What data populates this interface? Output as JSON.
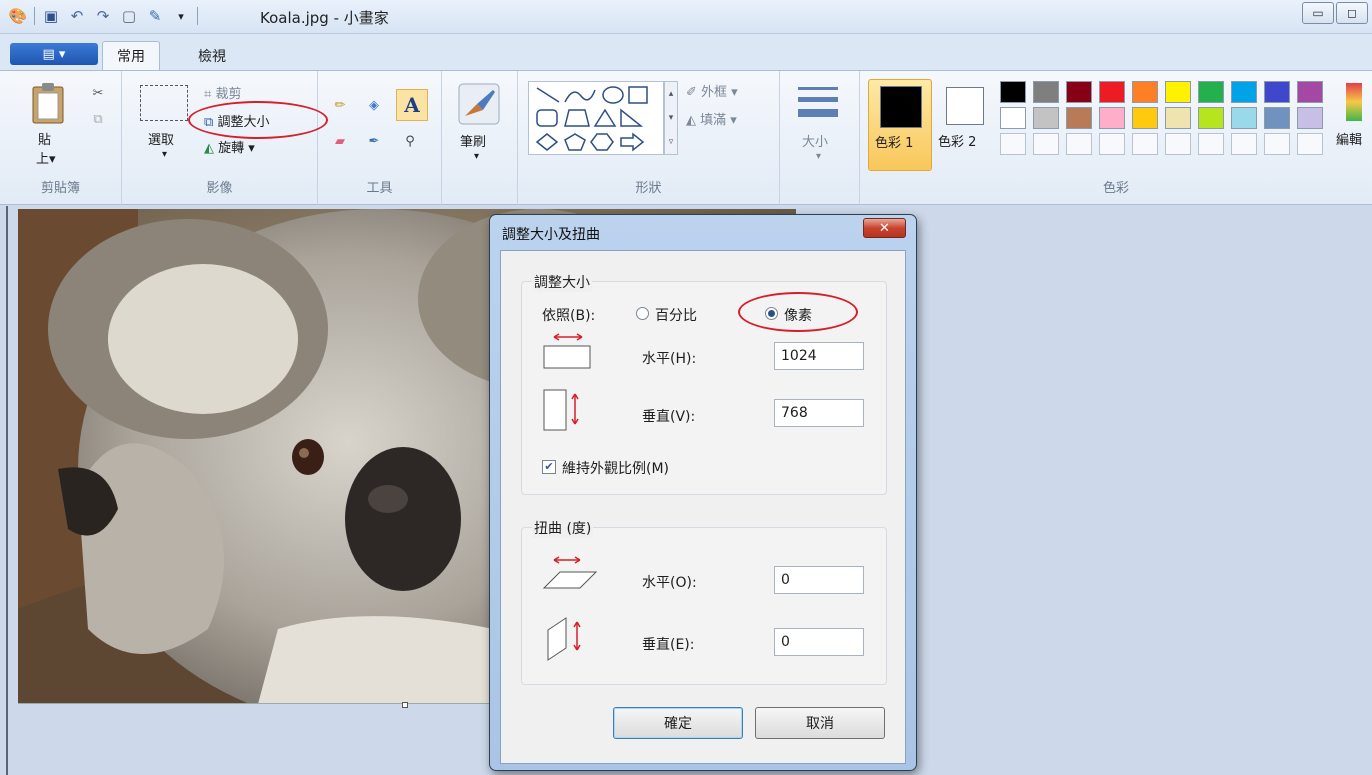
{
  "window": {
    "title": "Koala.jpg - 小畫家"
  },
  "tabs": {
    "home": "常用",
    "view": "檢視"
  },
  "clipboard": {
    "paste": "貼",
    "paste2": "上",
    "label": "剪貼簿"
  },
  "image": {
    "select": "選取",
    "crop": "裁剪",
    "resize": "調整大小",
    "rotate": "旋轉",
    "label": "影像"
  },
  "tools": {
    "label": "工具"
  },
  "brushes": {
    "label": "筆刷"
  },
  "shapes": {
    "outline": "外框",
    "fill": "填滿",
    "label": "形狀"
  },
  "size": {
    "label": "大小"
  },
  "colors": {
    "color1": "色彩 1",
    "color2": "色彩 2",
    "edit": "編輯",
    "label": "色彩",
    "palette_row1": [
      "#000000",
      "#7f7f7f",
      "#880015",
      "#ed1c24",
      "#ff7f27",
      "#fff200",
      "#22b14c",
      "#00a2e8",
      "#3f48cc",
      "#a349a4"
    ],
    "palette_row2": [
      "#ffffff",
      "#c3c3c3",
      "#b97a57",
      "#ffaec9",
      "#ffc90e",
      "#efe4b0",
      "#b5e61d",
      "#99d9ea",
      "#7092be",
      "#c8bfe7"
    ]
  },
  "dialog": {
    "title": "調整大小及扭曲",
    "resize_legend": "調整大小",
    "by_label": "依照(B):",
    "percent": "百分比",
    "pixels": "像素",
    "horizontal_label": "水平(H):",
    "horizontal_value": "1024",
    "vertical_label": "垂直(V):",
    "vertical_value": "768",
    "keep_ratio": "維持外觀比例(M)",
    "skew_legend": "扭曲 (度)",
    "skew_h_label": "水平(O):",
    "skew_h_value": "0",
    "skew_v_label": "垂直(E):",
    "skew_v_value": "0",
    "ok": "確定",
    "cancel": "取消"
  }
}
